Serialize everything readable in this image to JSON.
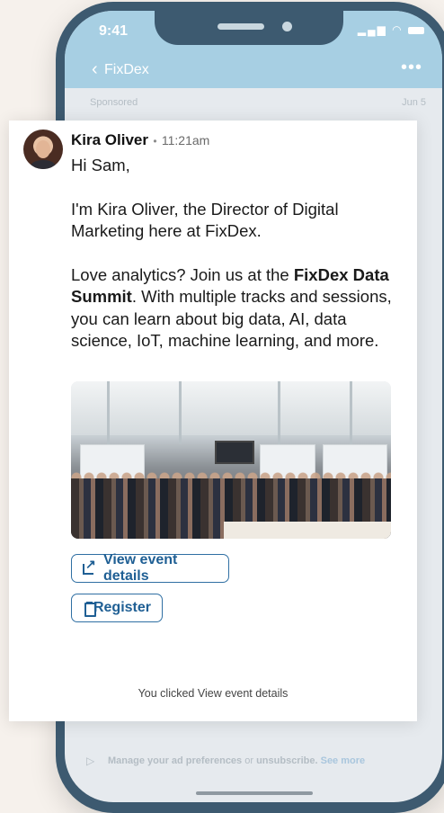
{
  "status_bar": {
    "time": "9:41"
  },
  "nav": {
    "title": "FixDex"
  },
  "header_row": {
    "sponsored": "Sponsored",
    "date": "Jun 5"
  },
  "message": {
    "sender_name": "Kira Oliver",
    "time": "11:21am",
    "greeting": "Hi Sam,",
    "paragraph1": "I'm Kira Oliver, the Director of Digital Marketing here at FixDex.",
    "paragraph2_prefix": "Love analytics? Join us at the ",
    "paragraph2_bold": "FixDex Data Summit",
    "paragraph2_suffix": ". With multiple tracks and sessions, you can learn about big data, AI, data science, IoT, machine learning, and more.",
    "buttons": {
      "view_label": "View event details",
      "register_label": "Register"
    },
    "status_note": "You clicked View event details"
  },
  "footer": {
    "text_a": "Manage your ad preferences",
    "text_b": " or ",
    "text_c": "unsubscribe.",
    "see_more": " See more"
  },
  "colors": {
    "accent": "#2f6fa3",
    "header_bg": "#a7cfe3",
    "phone_frame": "#3d5a70"
  }
}
